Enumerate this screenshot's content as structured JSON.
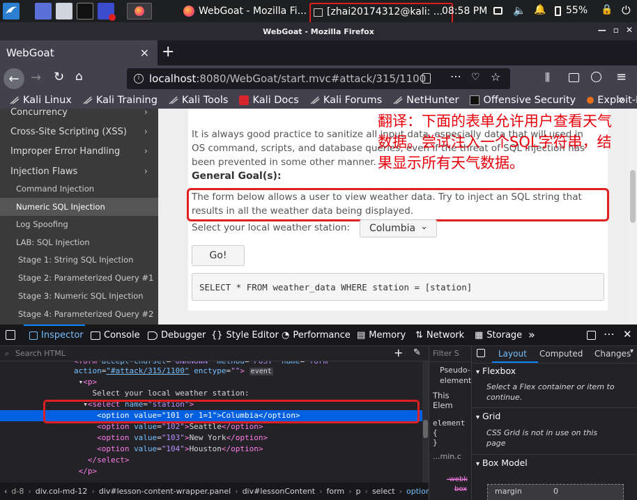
{
  "taskbar": {
    "firefox_task_label": "WebGoat - Mozilla Fi...",
    "terminal_task_label": "[zhai20174312@kali: ...",
    "clock": "08:58 PM",
    "battery": "55%"
  },
  "window": {
    "title": "WebGoat - Mozilla Firefox"
  },
  "tab": {
    "title": "WebGoat",
    "close": "×",
    "new": "+"
  },
  "nav": {
    "url_host": "localhost",
    "url_rest": ":8080/WebGoat/start.mvc#attack/315/1100"
  },
  "bookmarks": [
    "Kali Linux",
    "Kali Training",
    "Kali Tools",
    "Kali Docs",
    "Kali Forums",
    "NetHunter",
    "Offensive Security",
    "Exploit-DB"
  ],
  "sidebar": {
    "items": [
      {
        "label": "Concurrency"
      },
      {
        "label": "Cross-Site Scripting (XSS)"
      },
      {
        "label": "Improper Error Handling"
      },
      {
        "label": "Injection Flaws"
      }
    ],
    "subitems": [
      "Command Injection",
      "Numeric SQL Injection",
      "Log Spoofing",
      "LAB: SQL Injection",
      "Stage 1: String SQL Injection",
      "Stage 2: Parameterized Query #1",
      "Stage 3: Numeric SQL Injection",
      "Stage 4: Parameterized Query #2"
    ]
  },
  "lesson": {
    "intro_line1": "It is always good practice to sanitize all input data, especially data that will used in",
    "intro_line2": "OS command, scripts, and database queries, even if the threat of SQL injection has",
    "intro_line3": "been prevented in some other manner.",
    "goal_heading": "General Goal(s):",
    "goal_line1": "The form below allows a user to view weather data. Try to inject an SQL string that",
    "goal_line2": "results in all the weather data being displayed.",
    "station_label": "Select your local weather station:",
    "station_selected": "Columbia",
    "go_button": "Go!",
    "sql_query": "SELECT * FROM weather_data WHERE station = [station]"
  },
  "annotation": {
    "text": "翻译：下面的表单允许用户查看天气数据。尝试注入一个SQL字符串，结果显示所有天气数据。"
  },
  "devtools": {
    "tabs": [
      "Inspector",
      "Console",
      "Debugger",
      "Style Editor",
      "Performance",
      "Memory",
      "Network",
      "Storage"
    ],
    "search_placeholder": "Search HTML",
    "breadcrumbs": [
      "d-8",
      "div.col-md-12",
      "div#lesson-content-wrapper.panel",
      "div#lessonContent",
      "form",
      "p",
      "select",
      "option"
    ],
    "rules": {
      "filter": "Filter S",
      "pseudo": "Pseudo-",
      "element": "element",
      "this_element": "This Elem",
      "element_word": "element",
      "open_brace": "{",
      "close_brace": "}",
      "stylesheet": "...min.c"
    },
    "layout_tabs": [
      "Layout",
      "Computed",
      "Changes"
    ],
    "flexbox_heading": "Flexbox",
    "flexbox_text": "Select a Flex container or item to continue.",
    "grid_heading": "Grid",
    "grid_text": "CSS Grid is not in use on this page",
    "boxmodel_heading": "Box Model",
    "margin_label": "margin",
    "margin_value": "0"
  }
}
